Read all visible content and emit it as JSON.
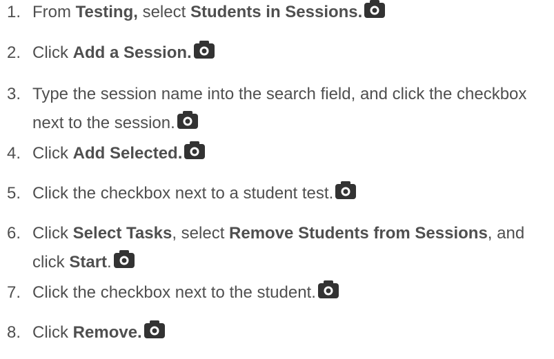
{
  "steps": [
    {
      "number": "1.",
      "segments": [
        {
          "text": "From ",
          "bold": false
        },
        {
          "text": "Testing,",
          "bold": true
        },
        {
          "text": " select ",
          "bold": false
        },
        {
          "text": "Students in Sessions.",
          "bold": true
        }
      ],
      "icon": "camera-icon"
    },
    {
      "number": "2.",
      "segments": [
        {
          "text": "Click ",
          "bold": false
        },
        {
          "text": "Add a Session.",
          "bold": true
        }
      ],
      "icon": "camera-icon"
    },
    {
      "number": "3.",
      "segments": [
        {
          "text": "Type the session name into the search field, and click the checkbox next to the session.",
          "bold": false
        }
      ],
      "icon": "camera-icon"
    },
    {
      "number": "4.",
      "segments": [
        {
          "text": "Click ",
          "bold": false
        },
        {
          "text": "Add Selected.",
          "bold": true
        }
      ],
      "icon": "camera-icon"
    },
    {
      "number": "5.",
      "segments": [
        {
          "text": "Click the checkbox next to a student test.",
          "bold": false
        }
      ],
      "icon": "camera-icon"
    },
    {
      "number": "6.",
      "segments": [
        {
          "text": "Click ",
          "bold": false
        },
        {
          "text": "Select Tasks",
          "bold": true
        },
        {
          "text": ", select ",
          "bold": false
        },
        {
          "text": "Remove Students from Sessions",
          "bold": true
        },
        {
          "text": ", and click ",
          "bold": false
        },
        {
          "text": "Start",
          "bold": true
        },
        {
          "text": ".",
          "bold": false
        }
      ],
      "icon": "camera-icon"
    },
    {
      "number": "7.",
      "segments": [
        {
          "text": "Click the checkbox next to the student.",
          "bold": false
        }
      ],
      "icon": "camera-icon"
    },
    {
      "number": "8.",
      "segments": [
        {
          "text": "Click ",
          "bold": false
        },
        {
          "text": "Remove.",
          "bold": true
        }
      ],
      "icon": "camera-icon"
    }
  ],
  "colors": {
    "text": "#4f4f4f",
    "icon_fill": "#333333",
    "icon_lens": "#ffffff"
  }
}
